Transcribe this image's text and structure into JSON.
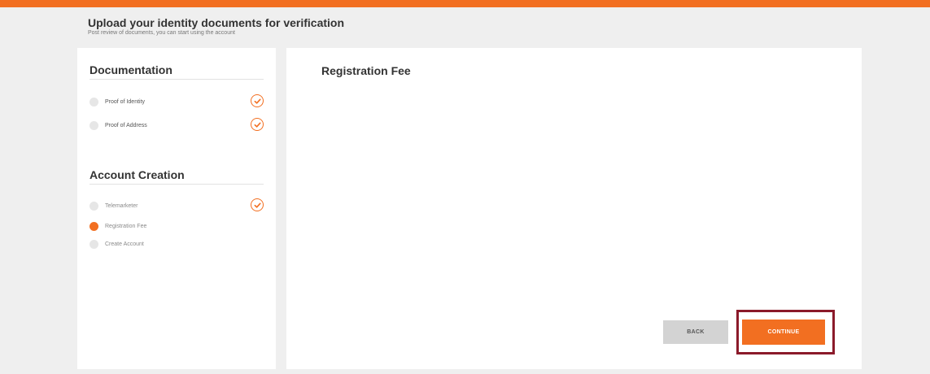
{
  "header": {
    "title": "Upload your identity documents for verification",
    "subtitle": "Post review of documents, you can start using the account"
  },
  "sidebar": {
    "sections": [
      {
        "title": "Documentation",
        "steps": [
          {
            "label": "Proof of Identity",
            "state": "done"
          },
          {
            "label": "Proof of Address",
            "state": "done"
          }
        ]
      },
      {
        "title": "Account Creation",
        "steps": [
          {
            "label": "Telemarketer",
            "state": "done"
          },
          {
            "label": "Registration Fee",
            "state": "active"
          },
          {
            "label": "Create Account",
            "state": "pending"
          }
        ]
      }
    ]
  },
  "main": {
    "title": "Registration Fee",
    "back_label": "BACK",
    "continue_label": "CONTINUE"
  },
  "colors": {
    "accent": "#f26f21",
    "highlight_border": "#8b1a2a",
    "background": "#efefef"
  },
  "icons": {
    "check": "check-circle-icon",
    "step_dot": "step-dot-icon"
  }
}
